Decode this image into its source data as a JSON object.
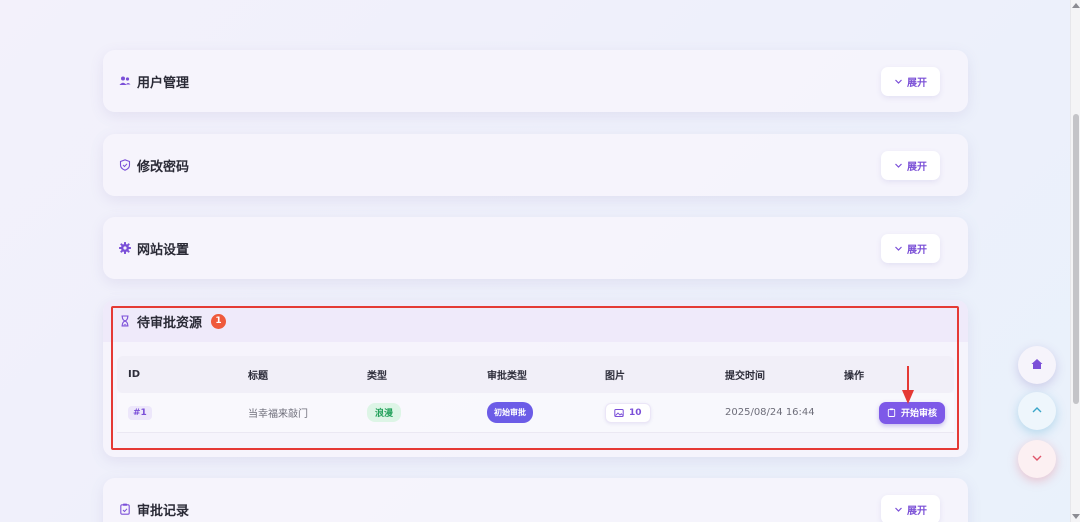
{
  "sections": {
    "user_mgmt": {
      "title": "用户管理",
      "expand": "展开"
    },
    "password": {
      "title": "修改密码",
      "expand": "展开"
    },
    "site": {
      "title": "网站设置",
      "expand": "展开"
    },
    "pending": {
      "title": "待审批资源",
      "count": "1",
      "columns": [
        "ID",
        "标题",
        "类型",
        "审批类型",
        "图片",
        "提交时间",
        "操作"
      ],
      "rows": [
        {
          "id": "#1",
          "title": "当幸福来敲门",
          "type": "浪漫",
          "approval_type": "初始审批",
          "images": "10",
          "submitted_at": "2025/08/24 16:44",
          "action": "开始审核"
        }
      ]
    },
    "records": {
      "title": "审批记录",
      "expand": "展开"
    }
  },
  "colors": {
    "accent": "#7b4fd8",
    "highlight": "#e53935",
    "badge": "#ef5a3b",
    "type_badge": "#23a15b"
  },
  "icons": [
    "users-icon",
    "shield-icon",
    "gear-icon",
    "hourglass-icon",
    "clipboard-icon",
    "chevron-down-icon",
    "image-icon",
    "home-icon",
    "chevron-up-icon"
  ]
}
